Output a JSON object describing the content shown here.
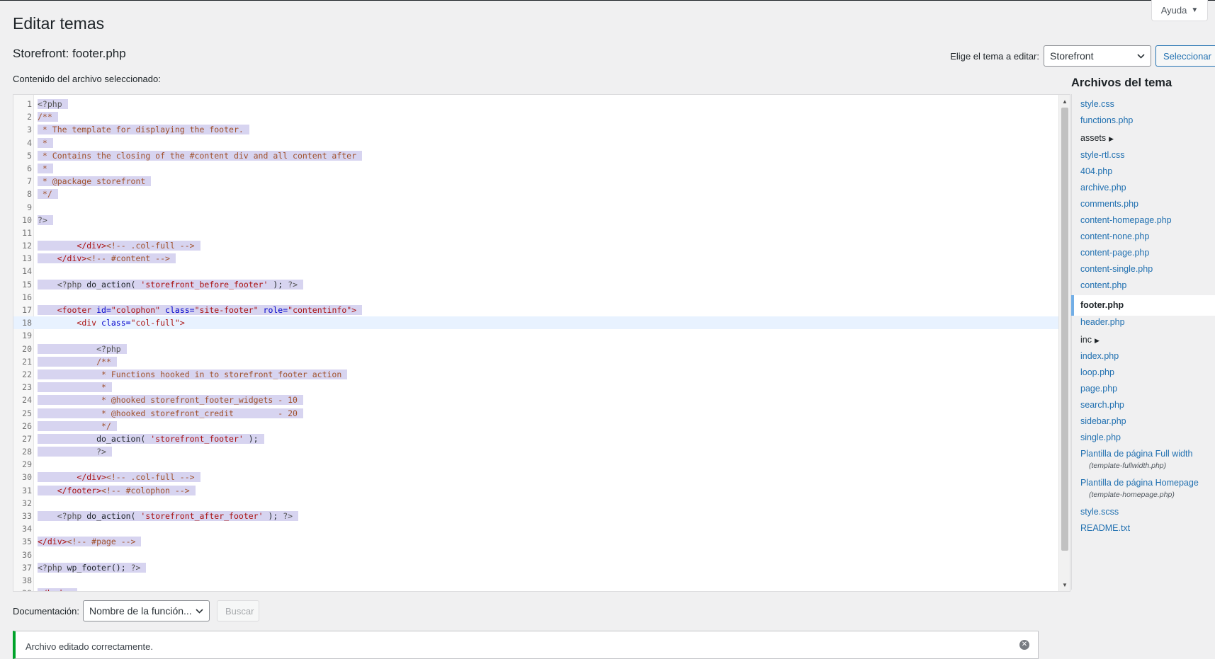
{
  "help": {
    "label": "Ayuda",
    "caret": "▼"
  },
  "page": {
    "title": "Editar temas",
    "file_title": "Storefront: footer.php",
    "content_label": "Contenido del archivo seleccionado:"
  },
  "theme_select": {
    "label": "Elige el tema a editar:",
    "value": "Storefront",
    "button": "Seleccionar"
  },
  "editor": {
    "active_line": 18,
    "lines": [
      [
        [
          "t-meta",
          "<?php"
        ]
      ],
      [
        [
          "t-cm",
          "/**"
        ]
      ],
      [
        [
          "t-cm",
          " * The template for displaying the footer."
        ]
      ],
      [
        [
          "t-cm",
          " *"
        ]
      ],
      [
        [
          "t-cm",
          " * Contains the closing of the #content div and all content after"
        ]
      ],
      [
        [
          "t-cm",
          " *"
        ]
      ],
      [
        [
          "t-cm",
          " * @package storefront"
        ]
      ],
      [
        [
          "t-cm",
          " */"
        ]
      ],
      [],
      [
        [
          "t-meta",
          "?>"
        ]
      ],
      [],
      [
        [
          "t-plain",
          "        "
        ],
        [
          "t-tag",
          "</div>"
        ],
        [
          "t-cm",
          "<!-- .col-full -->"
        ]
      ],
      [
        [
          "t-plain",
          "    "
        ],
        [
          "t-tag",
          "</div>"
        ],
        [
          "t-cm",
          "<!-- #content -->"
        ]
      ],
      [],
      [
        [
          "t-plain",
          "    "
        ],
        [
          "t-meta",
          "<?php "
        ],
        [
          "t-plain",
          "do_action( "
        ],
        [
          "t-str",
          "'storefront_before_footer'"
        ],
        [
          "t-plain",
          " ); "
        ],
        [
          "t-meta",
          "?>"
        ]
      ],
      [],
      [
        [
          "t-plain",
          "    "
        ],
        [
          "t-tag",
          "<footer "
        ],
        [
          "t-attr",
          "id="
        ],
        [
          "t-str",
          "\"colophon\""
        ],
        [
          "t-attr",
          " class="
        ],
        [
          "t-str",
          "\"site-footer\""
        ],
        [
          "t-attr",
          " role="
        ],
        [
          "t-str",
          "\"contentinfo\""
        ],
        [
          "t-tag",
          ">"
        ]
      ],
      [
        [
          "t-plain",
          "        "
        ],
        [
          "t-tag",
          "<div "
        ],
        [
          "t-attr",
          "class="
        ],
        [
          "t-str",
          "\"col-full\""
        ],
        [
          "t-tag",
          ">"
        ]
      ],
      [],
      [
        [
          "t-plain",
          "            "
        ],
        [
          "t-meta",
          "<?php"
        ]
      ],
      [
        [
          "t-plain",
          "            "
        ],
        [
          "t-cm",
          "/**"
        ]
      ],
      [
        [
          "t-plain",
          "            "
        ],
        [
          "t-cm",
          " * Functions hooked in to storefront_footer action"
        ]
      ],
      [
        [
          "t-plain",
          "            "
        ],
        [
          "t-cm",
          " *"
        ]
      ],
      [
        [
          "t-plain",
          "            "
        ],
        [
          "t-cm",
          " * @hooked storefront_footer_widgets - 10"
        ]
      ],
      [
        [
          "t-plain",
          "            "
        ],
        [
          "t-cm",
          " * @hooked storefront_credit         - 20"
        ]
      ],
      [
        [
          "t-plain",
          "            "
        ],
        [
          "t-cm",
          " */"
        ]
      ],
      [
        [
          "t-plain",
          "            do_action( "
        ],
        [
          "t-str",
          "'storefront_footer'"
        ],
        [
          "t-plain",
          " );"
        ]
      ],
      [
        [
          "t-plain",
          "            "
        ],
        [
          "t-meta",
          "?>"
        ]
      ],
      [],
      [
        [
          "t-plain",
          "        "
        ],
        [
          "t-tag",
          "</div>"
        ],
        [
          "t-cm",
          "<!-- .col-full -->"
        ]
      ],
      [
        [
          "t-plain",
          "    "
        ],
        [
          "t-tag",
          "</footer>"
        ],
        [
          "t-cm",
          "<!-- #colophon -->"
        ]
      ],
      [],
      [
        [
          "t-plain",
          "    "
        ],
        [
          "t-meta",
          "<?php "
        ],
        [
          "t-plain",
          "do_action( "
        ],
        [
          "t-str",
          "'storefront_after_footer'"
        ],
        [
          "t-plain",
          " ); "
        ],
        [
          "t-meta",
          "?>"
        ]
      ],
      [],
      [
        [
          "t-tag",
          "</div>"
        ],
        [
          "t-cm",
          "<!-- #page -->"
        ]
      ],
      [],
      [
        [
          "t-meta",
          "<?php "
        ],
        [
          "t-plain",
          "wp_footer(); "
        ],
        [
          "t-meta",
          "?>"
        ]
      ],
      [],
      [
        [
          "t-tag",
          "</body>"
        ]
      ]
    ]
  },
  "sidebar": {
    "title": "Archivos del tema",
    "items": [
      {
        "label": "style.css"
      },
      {
        "label": "functions.php"
      },
      {
        "label": "assets",
        "folder": true,
        "tri": "▶"
      },
      {
        "label": "style-rtl.css"
      },
      {
        "label": "404.php"
      },
      {
        "label": "archive.php"
      },
      {
        "label": "comments.php"
      },
      {
        "label": "content-homepage.php"
      },
      {
        "label": "content-none.php"
      },
      {
        "label": "content-page.php"
      },
      {
        "label": "content-single.php"
      },
      {
        "label": "content.php"
      },
      {
        "label": "footer.php",
        "current": true
      },
      {
        "label": "header.php"
      },
      {
        "label": "inc",
        "folder": true,
        "tri": "▶"
      },
      {
        "label": "index.php"
      },
      {
        "label": "loop.php"
      },
      {
        "label": "page.php"
      },
      {
        "label": "search.php"
      },
      {
        "label": "sidebar.php"
      },
      {
        "label": "single.php"
      },
      {
        "label": "Plantilla de página Full width",
        "sub": "(template-fullwidth.php)"
      },
      {
        "label": "Plantilla de página Homepage",
        "sub": "(template-homepage.php)"
      },
      {
        "label": "style.scss"
      },
      {
        "label": "README.txt"
      }
    ]
  },
  "documentation": {
    "label": "Documentación:",
    "select_value": "Nombre de la función...",
    "button": "Buscar"
  },
  "notice": {
    "message": "Archivo editado correctamente.",
    "dismiss_glyph": "✕"
  }
}
